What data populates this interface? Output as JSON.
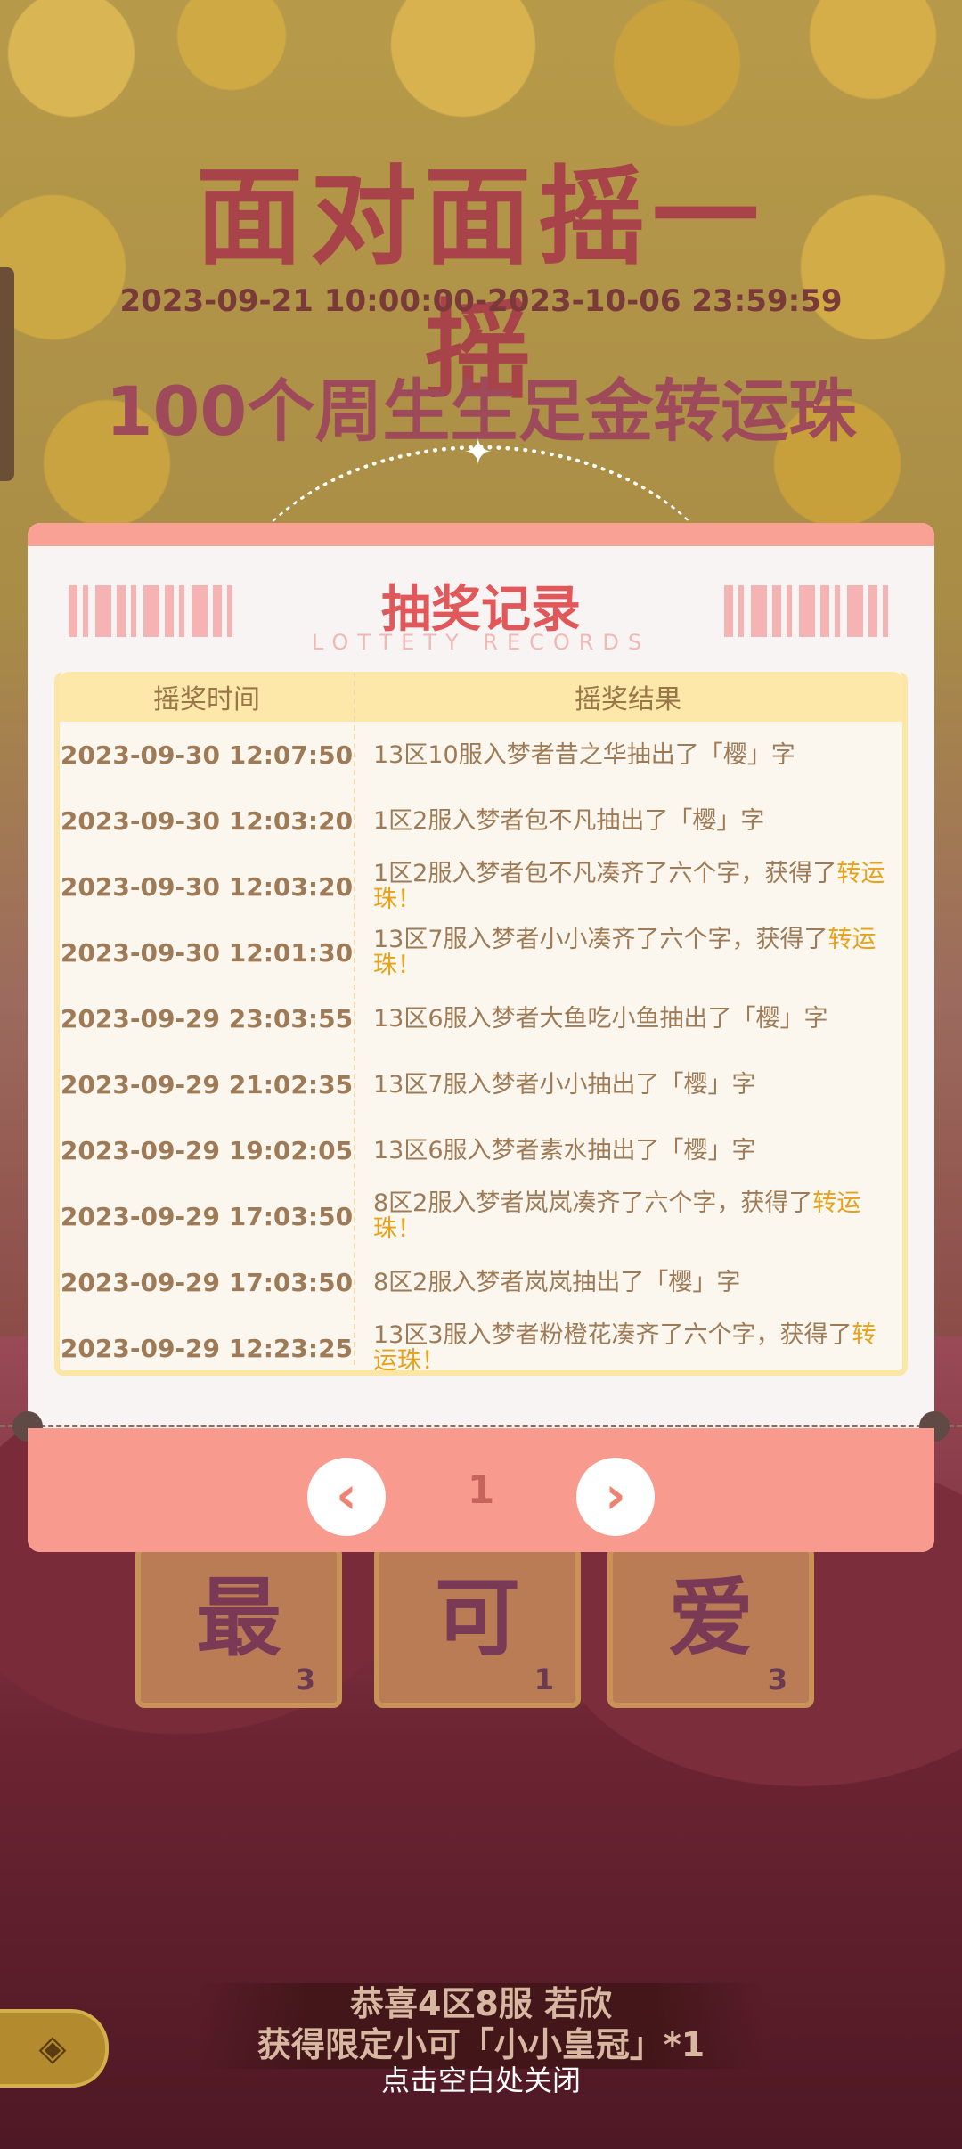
{
  "background": {
    "event_title": "面对面摇一摇",
    "event_dates": "2023-09-21 10:00:00-2023-10-06 23:59:59",
    "prize_line": "100个周生生足金转运珠",
    "tiles": [
      {
        "char": "最",
        "count": "3"
      },
      {
        "char": "可",
        "count": "1"
      },
      {
        "char": "爱",
        "count": "3"
      }
    ],
    "marquee_line1": "恭喜4区8服 若欣",
    "marquee_line2": "获得限定小可「小小皇冠」*1",
    "close_hint": "点击空白处关闭"
  },
  "modal": {
    "title": "抽奖记录",
    "subtitle": "LOTTETY RECORDS",
    "col_time": "摇奖时间",
    "col_result": "摇奖结果",
    "records": [
      {
        "time": "2023-09-30 12:07:50",
        "result": "13区10服入梦者昔之华抽出了「樱」字",
        "reward": ""
      },
      {
        "time": "2023-09-30 12:03:20",
        "result": "1区2服入梦者包不凡抽出了「樱」字",
        "reward": ""
      },
      {
        "time": "2023-09-30 12:03:20",
        "result": "1区2服入梦者包不凡凑齐了六个字，获得了",
        "reward": "转运珠！"
      },
      {
        "time": "2023-09-30 12:01:30",
        "result": "13区7服入梦者小小凑齐了六个字，获得了",
        "reward": "转运珠！"
      },
      {
        "time": "2023-09-29 23:03:55",
        "result": "13区6服入梦者大鱼吃小鱼抽出了「樱」字",
        "reward": ""
      },
      {
        "time": "2023-09-29 21:02:35",
        "result": "13区7服入梦者小小抽出了「樱」字",
        "reward": ""
      },
      {
        "time": "2023-09-29 19:02:05",
        "result": "13区6服入梦者素水抽出了「樱」字",
        "reward": ""
      },
      {
        "time": "2023-09-29 17:03:50",
        "result": "8区2服入梦者岚岚凑齐了六个字，获得了",
        "reward": "转运珠！"
      },
      {
        "time": "2023-09-29 17:03:50",
        "result": "8区2服入梦者岚岚抽出了「樱」字",
        "reward": ""
      },
      {
        "time": "2023-09-29 12:23:25",
        "result": "13区3服入梦者粉橙花凑齐了六个字，获得了",
        "reward": "转运珠！"
      }
    ],
    "pagination": {
      "prev_icon": "‹",
      "page": "1",
      "next_icon": "›"
    }
  },
  "colors": {
    "accent": "#e0585a",
    "reward_highlight": "#e8a21a",
    "footer": "#f99a8e"
  }
}
